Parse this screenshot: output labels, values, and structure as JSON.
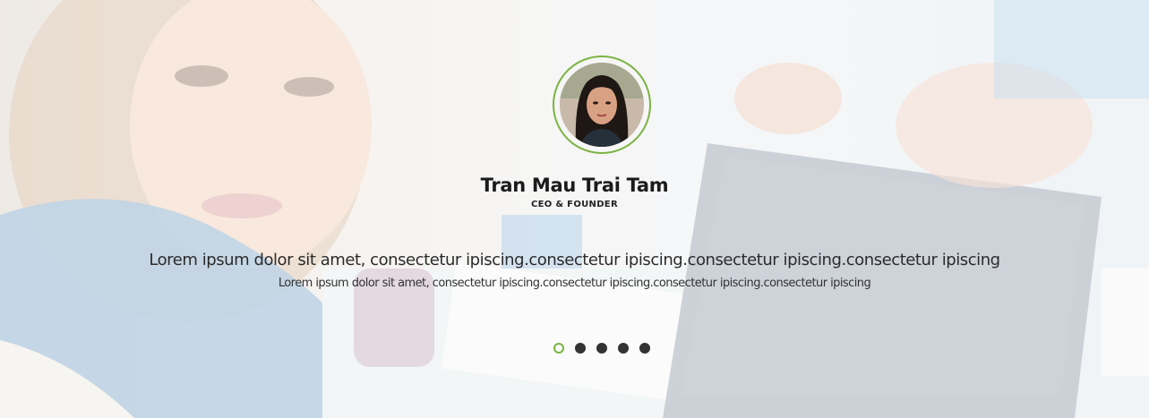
{
  "testimonial": {
    "name": "Tran Mau Trai Tam",
    "role": "CEO & FOUNDER",
    "quote_main": "Lorem ipsum dolor sit amet, consectetur ipiscing.consectetur ipiscing.consectetur ipiscing.consectetur ipiscing",
    "quote_sub": "Lorem ipsum dolor sit amet, consectetur ipiscing.consectetur ipiscing.consectetur ipiscing.consectetur ipiscing"
  },
  "pagination": {
    "total": 5,
    "active_index": 0
  },
  "colors": {
    "accent": "#7cb342",
    "dot": "#333333",
    "text": "#1b1b1b"
  },
  "icons": {
    "avatar": "person-photo-icon",
    "background": "office-photo"
  }
}
